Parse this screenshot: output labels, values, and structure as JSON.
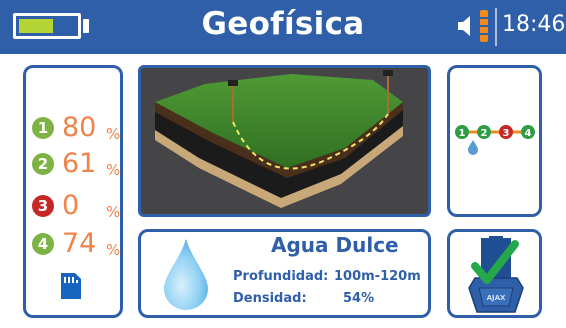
{
  "header": {
    "title": "Geofísica",
    "time": "18:46",
    "battery_level": 0.64,
    "colors": {
      "bar": "#2f5fa8",
      "battery_fill": "#b4d335",
      "signal": "#f08a1d"
    }
  },
  "sensors": [
    {
      "id": "1",
      "percent": "80",
      "unit": "%",
      "color": "#7cb342"
    },
    {
      "id": "2",
      "percent": "61",
      "unit": "%",
      "color": "#7cb342"
    },
    {
      "id": "3",
      "percent": "0",
      "unit": "%",
      "color": "#c62828"
    },
    {
      "id": "4",
      "percent": "74",
      "unit": "%",
      "color": "#7cb342"
    }
  ],
  "result": {
    "title": "Agua Dulce",
    "depth_label": "Profundidad:",
    "depth_value": "100m-120m",
    "density_label": "Densidad:",
    "density_value": "54%"
  },
  "chain": {
    "nodes": [
      {
        "label": "1",
        "color": "#2e9d45"
      },
      {
        "label": "2",
        "color": "#2e9d45"
      },
      {
        "label": "3",
        "color": "#c62828"
      },
      {
        "label": "4",
        "color": "#2e9d45"
      }
    ]
  },
  "device": {
    "brand": "AJAX"
  },
  "icons": {
    "battery": "battery-icon",
    "speaker": "speaker-icon",
    "signal": "signal-icon",
    "sd": "sd-card-icon",
    "drop": "water-drop-icon",
    "check": "checkmark-icon"
  }
}
